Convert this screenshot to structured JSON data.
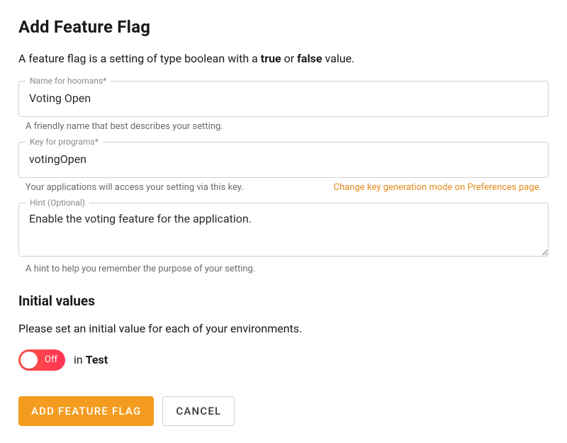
{
  "page": {
    "title": "Add Feature Flag",
    "description_pre": "A feature flag is a setting of type boolean with a ",
    "description_bold1": "true",
    "description_mid": " or ",
    "description_bold2": "false",
    "description_post": " value."
  },
  "fields": {
    "name": {
      "label": "Name for hoomans*",
      "value": "Voting Open",
      "helper": "A friendly name that best describes your setting."
    },
    "key": {
      "label": "Key for programs*",
      "value": "votingOpen",
      "helper": "Your applications will access your setting via this key.",
      "link": "Change key generation mode on Preferences page."
    },
    "hint": {
      "label": "Hint (Optional)",
      "value": "Enable the voting feature for the application.",
      "helper": "A hint to help you remember the purpose of your setting."
    }
  },
  "initial": {
    "title": "Initial values",
    "description": "Please set an initial value for each of your environments.",
    "toggle_state": "Off",
    "env_prefix": "in ",
    "env_name": "Test"
  },
  "buttons": {
    "primary": "Add Feature Flag",
    "secondary": "Cancel"
  }
}
